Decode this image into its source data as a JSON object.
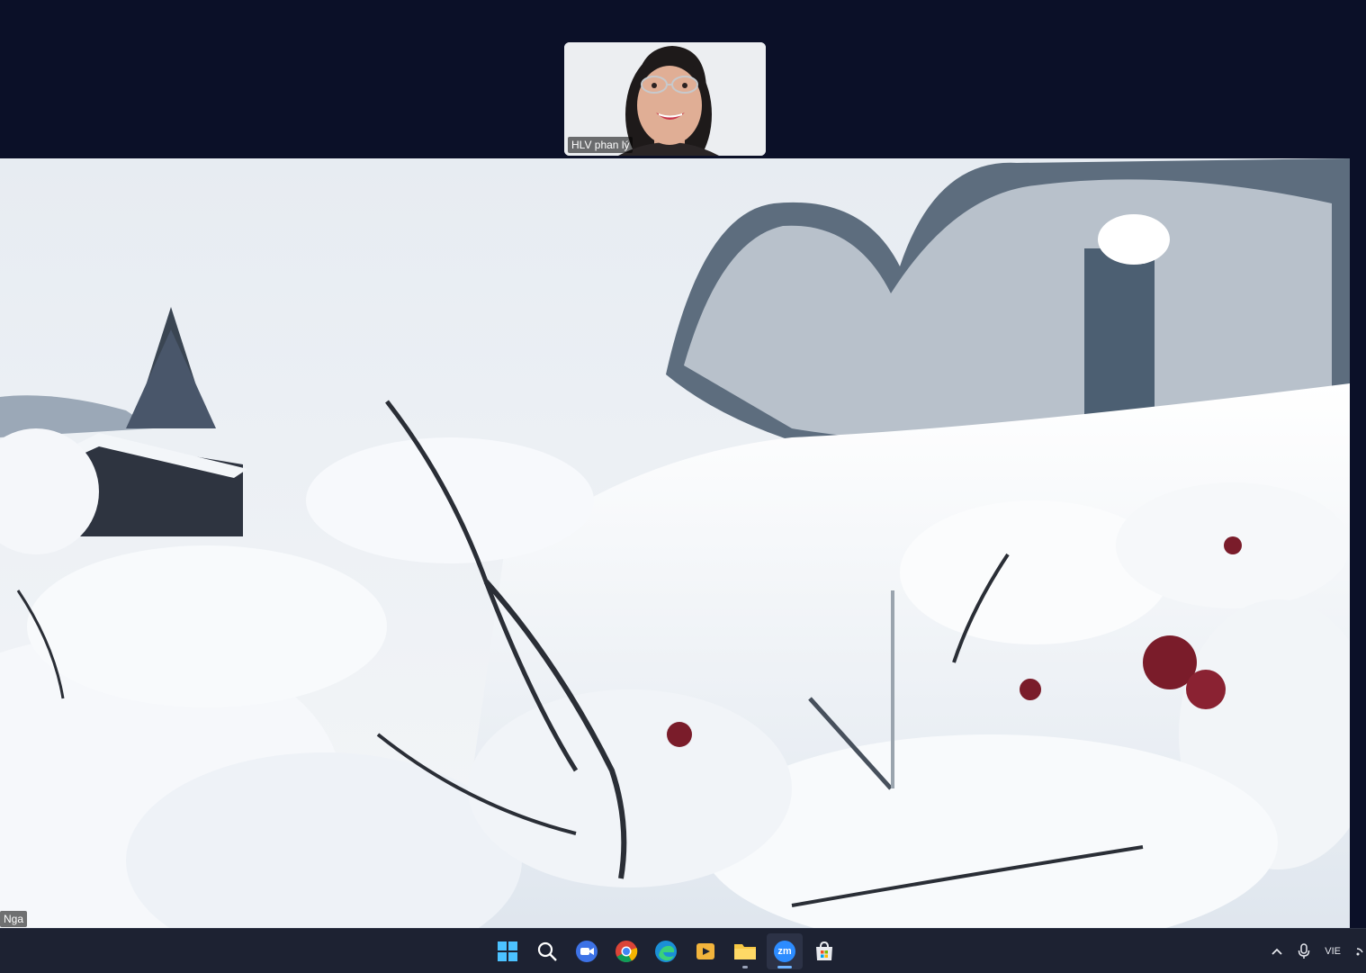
{
  "participants": {
    "thumbnail_name": "HLV phan lý",
    "main_name": "Nga"
  },
  "taskbar": {
    "apps": [
      {
        "name": "start-button",
        "icon": "windows-icon"
      },
      {
        "name": "search-button",
        "icon": "search-icon"
      },
      {
        "name": "zoom-meetings-button",
        "icon": "video-camera-icon"
      },
      {
        "name": "chrome-button",
        "icon": "chrome-icon"
      },
      {
        "name": "edge-button",
        "icon": "edge-icon"
      },
      {
        "name": "media-player-button",
        "icon": "media-player-icon"
      },
      {
        "name": "file-explorer-button",
        "icon": "folder-icon"
      },
      {
        "name": "zoom-app-button",
        "icon": "zoom-icon",
        "label": "zm"
      },
      {
        "name": "store-button",
        "icon": "store-icon"
      }
    ],
    "tray": {
      "language": "VIE"
    }
  },
  "colors": {
    "background": "#0b1028",
    "taskbar": "#1d2232",
    "accent": "#6fb3ff"
  }
}
